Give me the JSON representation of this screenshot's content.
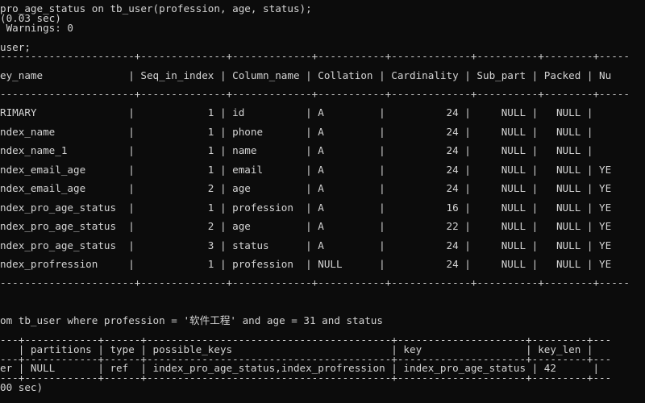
{
  "terminal": {
    "header": [
      "pro_age_status on tb_user(profession, age, status);",
      "(0.03 sec)",
      " Warnings: 0",
      "",
      "user;"
    ],
    "index_table": {
      "separator": "----------------------+--------------+-------------+-----------+-------------+----------+--------+-----",
      "header_row": "ey_name              | Seq_in_index | Column_name | Collation | Cardinality | Sub_part | Packed | Nu",
      "rows": [
        "RIMARY               |            1 | id          | A         |          24 |     NULL |   NULL |",
        "ndex_name            |            1 | phone       | A         |          24 |     NULL |   NULL |",
        "ndex_name_1          |            1 | name        | A         |          24 |     NULL |   NULL |",
        "ndex_email_age       |            1 | email       | A         |          24 |     NULL |   NULL | YE",
        "ndex_email_age       |            2 | age         | A         |          24 |     NULL |   NULL | YE",
        "ndex_pro_age_status  |            1 | profession  | A         |          16 |     NULL |   NULL | YE",
        "ndex_pro_age_status  |            2 | age         | A         |          22 |     NULL |   NULL | YE",
        "ndex_pro_age_status  |            3 | status      | A         |          24 |     NULL |   NULL | YE",
        "ndex_profression     |            1 | profession  | NULL      |          24 |     NULL |   NULL | YE"
      ]
    },
    "query_line": "om tb_user where profession = '软件工程' and age = 31 and status",
    "explain_table": {
      "separator": "---+------------+------+----------------------------------------+---------------------+---------+---",
      "header_row": "   | partitions | type | possible_keys                          | key                 | key_len | ",
      "row": "er | NULL       | ref  | index_pro_age_status,index_profression | index_pro_age_status | 42      | "
    },
    "footer": "00 sec)"
  }
}
